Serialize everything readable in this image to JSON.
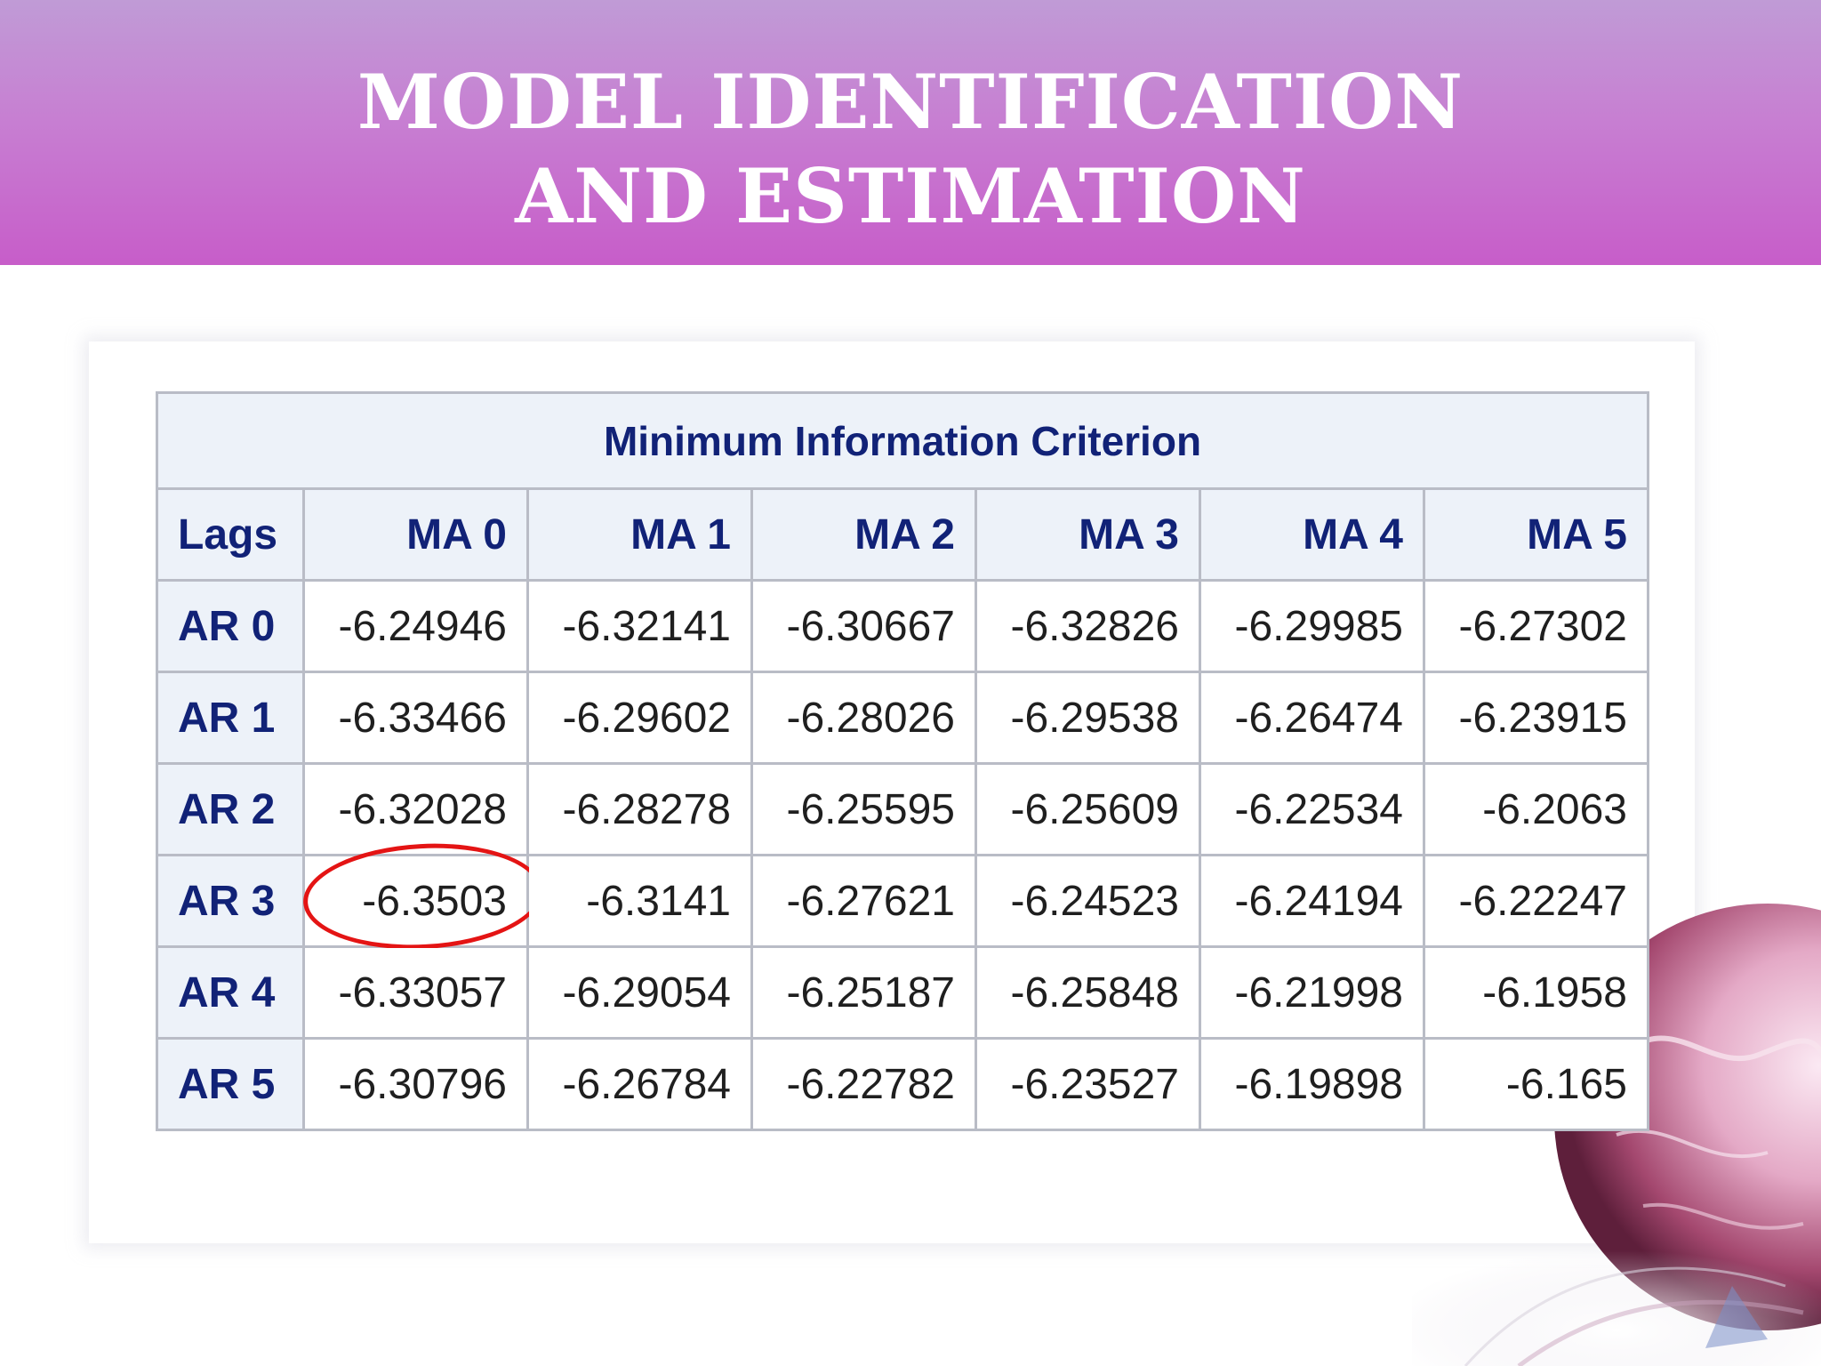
{
  "slide": {
    "title_line1": "MODEL IDENTIFICATION",
    "title_line2": "AND ESTIMATION"
  },
  "table": {
    "caption": "Minimum Information Criterion",
    "corner_header": "Lags",
    "column_headers": [
      "MA 0",
      "MA 1",
      "MA 2",
      "MA 3",
      "MA 4",
      "MA 5"
    ],
    "rows": [
      {
        "label": "AR 0",
        "values": [
          "-6.24946",
          "-6.32141",
          "-6.30667",
          "-6.32826",
          "-6.29985",
          "-6.27302"
        ]
      },
      {
        "label": "AR 1",
        "values": [
          "-6.33466",
          "-6.29602",
          "-6.28026",
          "-6.29538",
          "-6.26474",
          "-6.23915"
        ]
      },
      {
        "label": "AR 2",
        "values": [
          "-6.32028",
          "-6.28278",
          "-6.25595",
          "-6.25609",
          "-6.22534",
          "-6.2063"
        ]
      },
      {
        "label": "AR 3",
        "values": [
          "-6.3503",
          "-6.3141",
          "-6.27621",
          "-6.24523",
          "-6.24194",
          "-6.22247"
        ]
      },
      {
        "label": "AR 4",
        "values": [
          "-6.33057",
          "-6.29054",
          "-6.25187",
          "-6.25848",
          "-6.21998",
          "-6.1958"
        ]
      },
      {
        "label": "AR 5",
        "values": [
          "-6.30796",
          "-6.26784",
          "-6.22782",
          "-6.23527",
          "-6.19898",
          "-6.165"
        ]
      }
    ],
    "highlighted_cell": {
      "row": "AR 3",
      "column": "MA 0",
      "value": "-6.3503",
      "highlight_color": "#e41414"
    }
  },
  "colors": {
    "header_band_top": "#c09bd6",
    "header_band_bottom": "#c75dc9",
    "header_text": "#112277",
    "header_cell_bg": "#edf2f9",
    "grid_line": "#b9bcc6"
  }
}
